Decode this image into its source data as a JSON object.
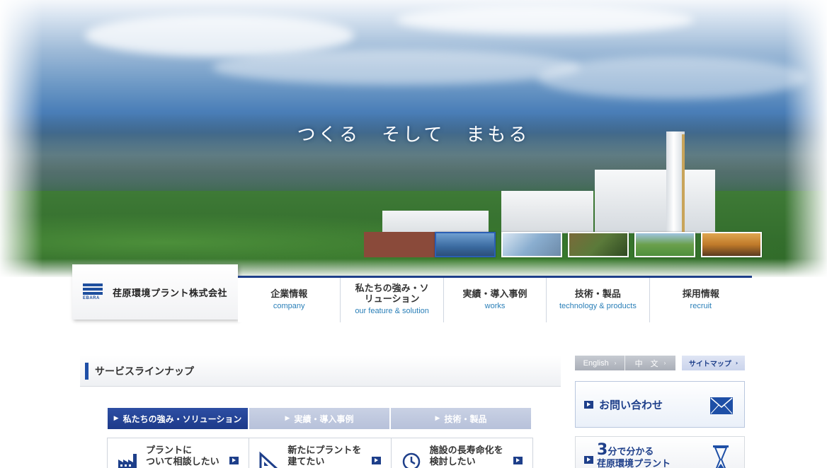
{
  "hero": {
    "tagline": "つくる　そして　まもる",
    "thumbnails": [
      {
        "name": "thumb-1",
        "color": "#3a6aa0"
      },
      {
        "name": "thumb-2",
        "color": "#8aaed0"
      },
      {
        "name": "thumb-3",
        "color": "#5b7a3a"
      },
      {
        "name": "thumb-4",
        "color": "#4e8f3c"
      },
      {
        "name": "thumb-5",
        "color": "#c07a2a"
      }
    ]
  },
  "header": {
    "company_name": "荏原環境プラント株式会社",
    "logo_text": "EBARA"
  },
  "nav": {
    "items": [
      {
        "ja": "企業情報",
        "en": "company"
      },
      {
        "ja": "私たちの強み・ソリューション",
        "en": "our feature & solution"
      },
      {
        "ja": "実績・導入事例",
        "en": "works"
      },
      {
        "ja": "技術・製品",
        "en": "technology & products"
      },
      {
        "ja": "採用情報",
        "en": "recruit"
      }
    ]
  },
  "main": {
    "section_title": "サービスラインナップ",
    "tabs": [
      {
        "label": "私たちの強み・ソリューション",
        "active": true
      },
      {
        "label": "実績・導入事例",
        "active": false
      },
      {
        "label": "技術・製品",
        "active": false
      }
    ],
    "cards": [
      {
        "line1": "プラントに",
        "line2": "ついて相談したい",
        "icon": "factory-icon"
      },
      {
        "line1": "新たにプラントを",
        "line2": "建てたい",
        "icon": "ruler-icon"
      },
      {
        "line1": "施設の長寿命化を",
        "line2": "検討したい",
        "icon": "clock-icon"
      }
    ]
  },
  "sidebar": {
    "english_label": "English",
    "chinese_label": "中　文",
    "sitemap_label": "サイトマップ",
    "contact_label": "お問い合わせ",
    "three_min_number": "3",
    "three_min_line1": "分で分かる",
    "three_min_line2": "荏原環境プラント"
  },
  "colors": {
    "brand_navy": "#1e3f8a",
    "accent_blue": "#2a7fb8"
  }
}
